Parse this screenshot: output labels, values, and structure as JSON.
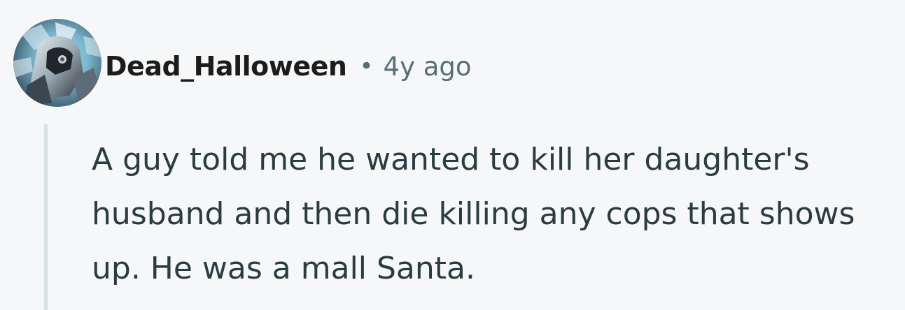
{
  "comment": {
    "author": "Dead_Halloween",
    "separator": "•",
    "time": "4y ago",
    "text": "A guy told me he wanted to kill her daughter's husband and then die killing any cops that shows up. He was a mall Santa."
  },
  "colors": {
    "background": "#f6f7f8",
    "author": "#1c1c1c",
    "meta": "#576f76",
    "body": "#2a3c42",
    "thread_line": "#d9e0e3"
  },
  "icons": {
    "avatar": "user-avatar-armored-figure"
  }
}
